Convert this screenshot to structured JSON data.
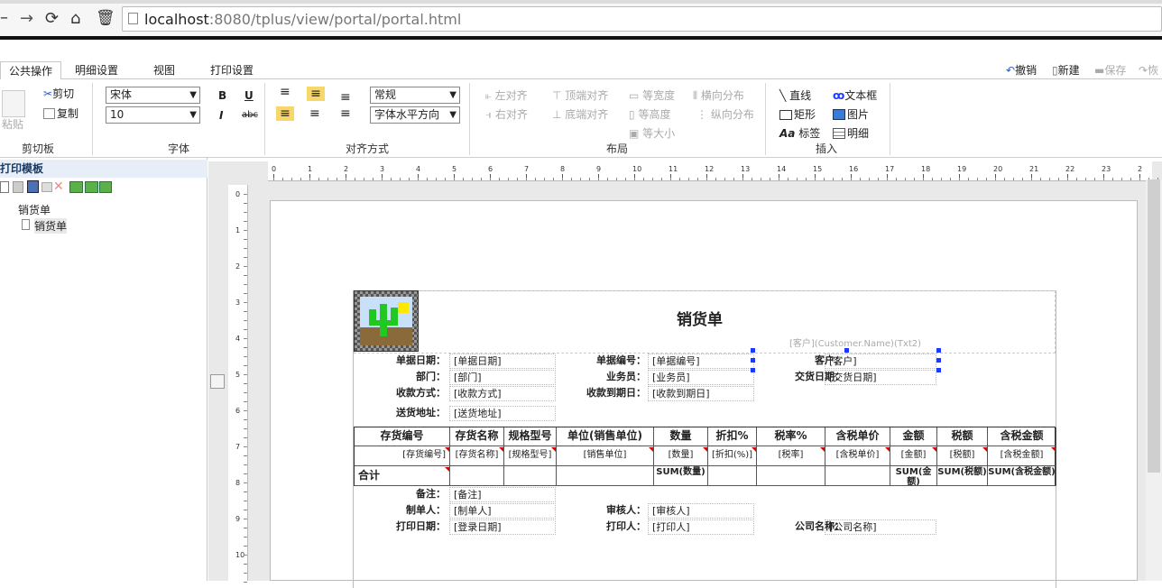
{
  "browser": {
    "url_host": "localhost",
    "url_rest": ":8080/tplus/view/portal/portal.html"
  },
  "ribbon_tabs": [
    "公共操作",
    "明细设置",
    "视图",
    "打印设置"
  ],
  "ribbon_actions": {
    "undo": "撤销",
    "new": "新建",
    "save": "保存",
    "recover": "恢"
  },
  "clipboard": {
    "paste": "粘贴",
    "cut": "剪切",
    "copy": "复制",
    "group": "剪切板"
  },
  "font": {
    "family": "宋体",
    "size": "10",
    "bold": "B",
    "underline": "U",
    "italic": "I",
    "strike": "abc",
    "group": "字体"
  },
  "align": {
    "style": "常规",
    "hpos": "字体水平方向",
    "group": "对齐方式"
  },
  "layout": {
    "left": "左对齐",
    "right": "右对齐",
    "top": "顶端对齐",
    "bottom": "底端对齐",
    "same_width": "等宽度",
    "same_height": "等高度",
    "same_size": "等大小",
    "hdist": "横向分布",
    "vdist": "纵向分布",
    "group": "布局"
  },
  "insert": {
    "line": "直线",
    "textbox": "文本框",
    "rect": "矩形",
    "image": "图片",
    "label": "标签",
    "detail": "明细",
    "group": "插入"
  },
  "left_panel": {
    "title": "打印模板",
    "tree_root": "销货单",
    "tree_child": "销货单"
  },
  "ruler_h": [
    "0",
    "1",
    "2",
    "3",
    "4",
    "5",
    "6",
    "7",
    "8",
    "9",
    "10",
    "11",
    "12",
    "13",
    "14",
    "15",
    "16",
    "17",
    "18",
    "19",
    "20",
    "21",
    "22",
    "23",
    "2"
  ],
  "ruler_v": [
    "0",
    "1",
    "2",
    "3",
    "4",
    "5",
    "6",
    "7",
    "8",
    "9",
    "10"
  ],
  "report": {
    "title": "销货单",
    "customer_ph": "[客户](Customer.Name)(Txt2)",
    "header_rows": [
      {
        "l1": "单据日期：",
        "v1": "[单据日期]",
        "l2": "单据编号：",
        "v2": "[单据编号]",
        "l3": "客户：",
        "v3": "[客户]"
      },
      {
        "l1": "部门：",
        "v1": "[部门]",
        "l2": "业务员：",
        "v2": "[业务员]",
        "l3": "交货日期：",
        "v3": "[交货日期]"
      },
      {
        "l1": "收款方式：",
        "v1": "[收款方式]",
        "l2": "收款到期日：",
        "v2": "[收款到期日]",
        "l3": "",
        "v3": ""
      },
      {
        "l1": "送货地址：",
        "v1": "[送货地址]",
        "l2": "",
        "v2": "",
        "l3": "",
        "v3": ""
      }
    ],
    "columns": [
      "存货编号",
      "存货名称",
      "规格型号",
      "单位(销售单位)",
      "数量",
      "折扣%",
      "税率%",
      "含税单价",
      "金额",
      "税额",
      "含税金额"
    ],
    "detail_row": [
      "[存货编号]",
      "[存货名称]",
      "[规格型号]",
      "[销售单位]",
      "[数量]",
      "[折扣(%)]",
      "[税率]",
      "[含税单价]",
      "[金额]",
      "[税额]",
      "[含税金额]"
    ],
    "total_row": [
      "合计",
      "",
      "",
      "",
      "SUM(数量)",
      "",
      "",
      "",
      "SUM(金额)",
      "SUM(税额)",
      "SUM(含税金额)"
    ],
    "footer_rows": [
      {
        "l1": "备注：",
        "v1": "[备注]",
        "l2": "",
        "v2": "",
        "l3": "",
        "v3": ""
      },
      {
        "l1": "制单人：",
        "v1": "[制单人]",
        "l2": "审核人：",
        "v2": "[审核人]",
        "l3": "",
        "v3": ""
      },
      {
        "l1": "打印日期：",
        "v1": "[登录日期]",
        "l2": "打印人：",
        "v2": "[打印人]",
        "l3": "公司名称：",
        "v3": "[公司名称]"
      }
    ]
  },
  "colors": {
    "accent": "#1a3aff",
    "flag": "#dd0000",
    "panel_title": "#e7eef7"
  }
}
